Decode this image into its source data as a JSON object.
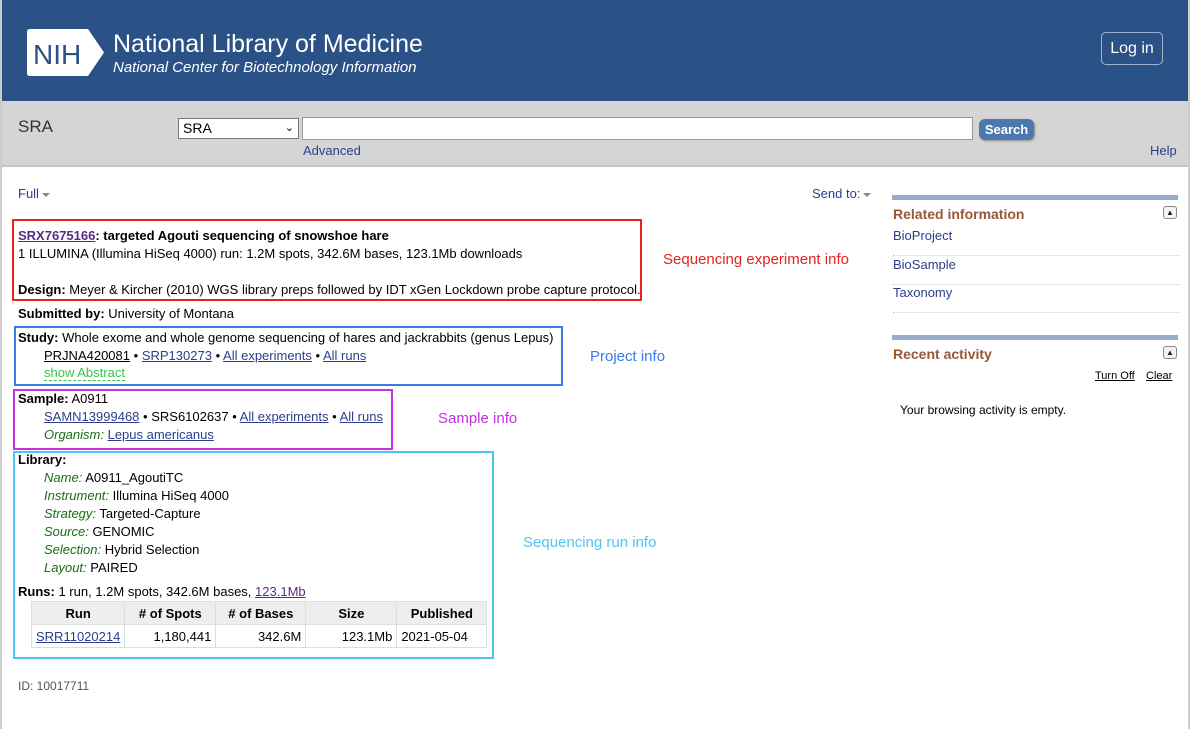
{
  "header": {
    "logo_text": "NIH",
    "title": "National Library of Medicine",
    "subtitle": "National Center for Biotechnology Information",
    "login": "Log in",
    "brand_color": "#2B5287"
  },
  "search": {
    "db_label": "SRA",
    "db_selected": "SRA",
    "query": "",
    "search_btn": "Search",
    "advanced": "Advanced",
    "help": "Help"
  },
  "toolbar": {
    "format": "Full",
    "send_to": "Send to:"
  },
  "experiment": {
    "accession": "SRX7675166",
    "title": ": targeted Agouti sequencing of snowshoe hare",
    "summary": "1 ILLUMINA (Illumina HiSeq 4000) run: 1.2M spots, 342.6M bases, 123.1Mb downloads",
    "design_label": "Design:",
    "design": "Meyer & Kircher (2010) WGS library preps followed by IDT xGen Lockdown probe capture protocol.",
    "submitted_label": "Submitted by:",
    "submitted": "University of Montana"
  },
  "study": {
    "label": "Study:",
    "title": "Whole exome and whole genome sequencing of hares and jackrabbits (genus Lepus)",
    "bioproject": "PRJNA420081",
    "srp": "SRP130273",
    "all_experiments": "All experiments",
    "all_runs": "All runs",
    "show_abstract": "show Abstract",
    "sep": "•"
  },
  "sample": {
    "label": "Sample:",
    "name": "A0911",
    "biosample": "SAMN13999468",
    "srs": "SRS6102637",
    "all_experiments": "All experiments",
    "all_runs": "All runs",
    "organism_label": "Organism:",
    "organism": "Lepus americanus",
    "sep": "•"
  },
  "library": {
    "label": "Library:",
    "fields": [
      {
        "k": "Name:",
        "v": "A0911_AgoutiTC"
      },
      {
        "k": "Instrument:",
        "v": "Illumina HiSeq 4000"
      },
      {
        "k": "Strategy:",
        "v": "Targeted-Capture"
      },
      {
        "k": "Source:",
        "v": "GENOMIC"
      },
      {
        "k": "Selection:",
        "v": "Hybrid Selection"
      },
      {
        "k": "Layout:",
        "v": "PAIRED"
      }
    ]
  },
  "runs": {
    "label": "Runs:",
    "summary": "1 run, 1.2M spots, 342.6M bases,",
    "size_link": "123.1Mb",
    "columns": [
      "Run",
      "# of Spots",
      "# of Bases",
      "Size",
      "Published"
    ],
    "rows": [
      [
        "SRR11020214",
        "1,180,441",
        "342.6M",
        "123.1Mb",
        "2021-05-04"
      ]
    ]
  },
  "id_line": "ID: 10017711",
  "annotations": {
    "experiment": "Sequencing experiment info",
    "project": "Project info",
    "sample": "Sample info",
    "run": "Sequencing run info",
    "colors": {
      "experiment": "#E8201E",
      "project": "#3B7BE8",
      "sample": "#C232E0",
      "run": "#4CC6F2"
    }
  },
  "sidebar": {
    "related_title": "Related information",
    "related": [
      "BioProject",
      "BioSample",
      "Taxonomy"
    ],
    "recent_title": "Recent activity",
    "turn_off": "Turn Off",
    "clear": "Clear",
    "empty": "Your browsing activity is empty."
  }
}
